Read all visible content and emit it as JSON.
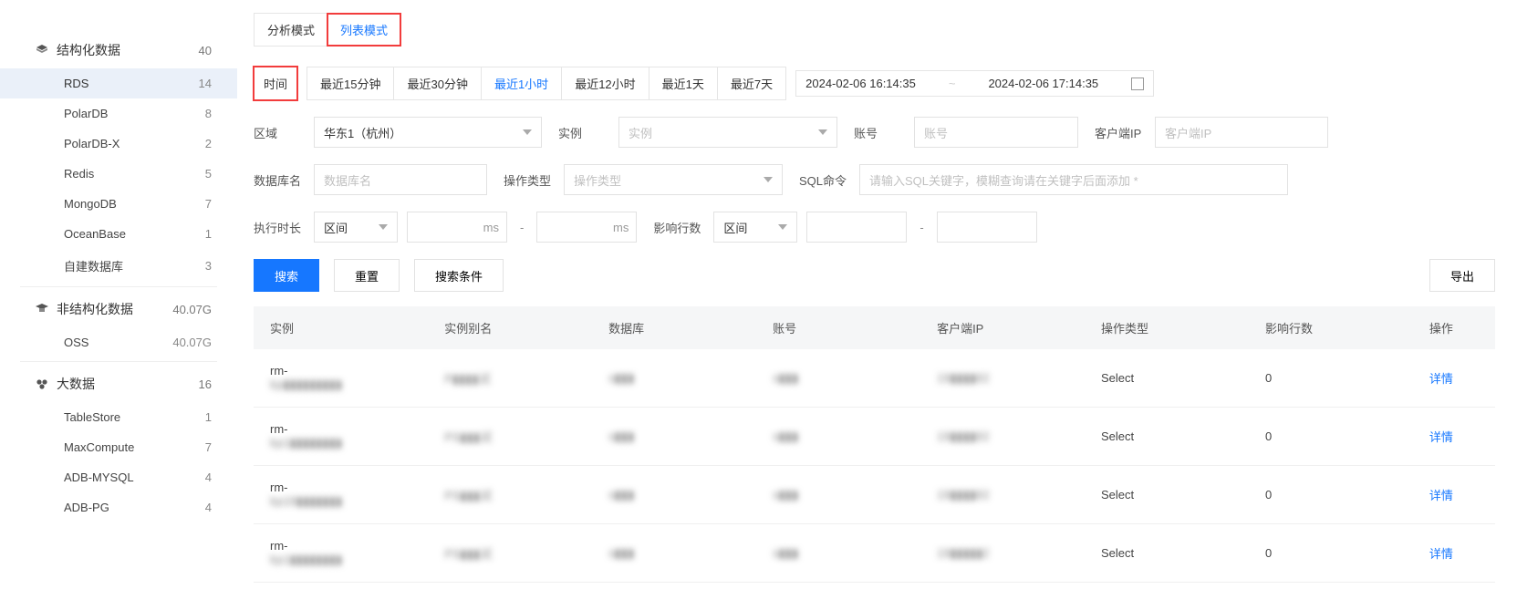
{
  "sidebar": {
    "cats": [
      {
        "label": "结构化数据",
        "count": "40",
        "items": [
          {
            "label": "RDS",
            "count": "14",
            "active": true
          },
          {
            "label": "PolarDB",
            "count": "8"
          },
          {
            "label": "PolarDB-X",
            "count": "2"
          },
          {
            "label": "Redis",
            "count": "5"
          },
          {
            "label": "MongoDB",
            "count": "7"
          },
          {
            "label": "OceanBase",
            "count": "1"
          },
          {
            "label": "自建数据库",
            "count": "3"
          }
        ]
      },
      {
        "label": "非结构化数据",
        "count": "40.07G",
        "items": [
          {
            "label": "OSS",
            "count": "40.07G"
          }
        ]
      },
      {
        "label": "大数据",
        "count": "16",
        "items": [
          {
            "label": "TableStore",
            "count": "1"
          },
          {
            "label": "MaxCompute",
            "count": "7"
          },
          {
            "label": "ADB-MYSQL",
            "count": "4"
          },
          {
            "label": "ADB-PG",
            "count": "4"
          }
        ]
      }
    ]
  },
  "modeTabs": {
    "analysis": "分析模式",
    "list": "列表模式"
  },
  "time": {
    "label": "时间",
    "opts": [
      "最近15分钟",
      "最近30分钟",
      "最近1小时",
      "最近12小时",
      "最近1天",
      "最近7天"
    ],
    "activeIdx": 2,
    "start": "2024-02-06 16:14:35",
    "sep": "~",
    "end": "2024-02-06 17:14:35"
  },
  "filters": {
    "region": {
      "label": "区域",
      "value": "华东1（杭州）"
    },
    "instance": {
      "label": "实例",
      "placeholder": "实例"
    },
    "account": {
      "label": "账号",
      "placeholder": "账号"
    },
    "clientip": {
      "label": "客户端IP",
      "placeholder": "客户端IP"
    },
    "db": {
      "label": "数据库名",
      "placeholder": "数据库名"
    },
    "optype": {
      "label": "操作类型",
      "placeholder": "操作类型"
    },
    "sql": {
      "label": "SQL命令",
      "placeholder": "请输入SQL关键字，模糊查询请在关键字后面添加 *"
    },
    "dur": {
      "label": "执行时长",
      "mode": "区间",
      "unit": "ms"
    },
    "rows": {
      "label": "影响行数",
      "mode": "区间"
    },
    "dash": "-"
  },
  "buttons": {
    "search": "搜索",
    "reset": "重置",
    "cond": "搜索条件",
    "export": "导出"
  },
  "table": {
    "headers": [
      "实例",
      "实例别名",
      "数据库",
      "账号",
      "客户端IP",
      "操作类型",
      "影响行数",
      "操作"
    ],
    "rows": [
      {
        "inst_a": "rm-",
        "inst_b": "bp▮▮▮▮▮▮▮▮▮",
        "alias": "P▮▮▮▮试",
        "db": "s▮▮▮",
        "acct": "s▮▮▮",
        "ip": "19▮▮▮▮92",
        "op": "Select",
        "rows": "0",
        "action": "详情"
      },
      {
        "inst_a": "rm-",
        "inst_b": "bp1▮▮▮▮▮▮▮▮",
        "alias": "PS▮▮▮试",
        "db": "s▮▮▮",
        "acct": "s▮▮▮",
        "ip": "19▮▮▮▮92",
        "op": "Select",
        "rows": "0",
        "action": "详情"
      },
      {
        "inst_a": "rm-",
        "inst_b": "bp18▮▮▮▮▮▮▮",
        "alias": "PS▮▮▮试",
        "db": "s▮▮▮",
        "acct": "s▮▮▮",
        "ip": "19▮▮▮▮92",
        "op": "Select",
        "rows": "0",
        "action": "详情"
      },
      {
        "inst_a": "rm-",
        "inst_b": "bp1▮▮▮▮▮▮▮▮",
        "alias": "PS▮▮▮试",
        "db": "s▮▮▮",
        "acct": "s▮▮▮",
        "ip": "19▮▮▮▮▮2",
        "op": "Select",
        "rows": "0",
        "action": "详情"
      }
    ]
  }
}
